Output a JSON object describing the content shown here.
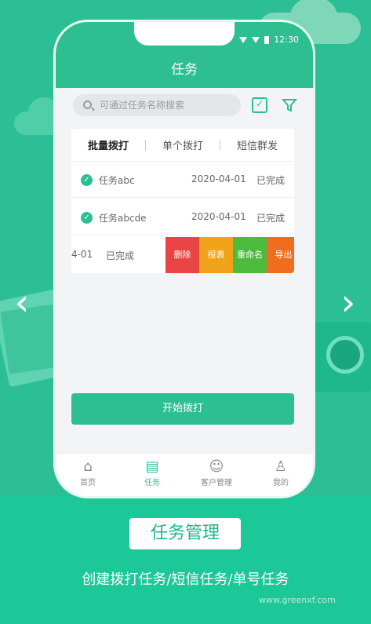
{
  "status_bar": {
    "time": "12:30"
  },
  "app": {
    "title": "任务"
  },
  "search": {
    "placeholder": "可通过任务名称搜索"
  },
  "tabs": [
    {
      "label": "批量拨打",
      "active": true
    },
    {
      "label": "单个拨打",
      "active": false
    },
    {
      "label": "短信群发",
      "active": false
    }
  ],
  "tasks": [
    {
      "name": "任务abc",
      "date": "2020-04-01",
      "status": "已完成"
    },
    {
      "name": "任务abcde",
      "date": "2020-04-01",
      "status": "已完成"
    },
    {
      "date": "-04-01",
      "status": "已完成"
    }
  ],
  "swipe_actions": [
    "删除",
    "报表",
    "重命名",
    "导出"
  ],
  "start_button": "开始拨打",
  "nav": [
    {
      "label": "首页",
      "icon": "home-icon"
    },
    {
      "label": "任务",
      "icon": "task-icon",
      "active": true
    },
    {
      "label": "客户管理",
      "icon": "customer-icon"
    },
    {
      "label": "我的",
      "icon": "profile-icon"
    }
  ],
  "promo": {
    "title": "任务管理",
    "subtitle": "创建拨打任务/短信任务/单号任务"
  },
  "watermark": "www.greenxf.com",
  "colors": {
    "primary": "#2dbf90",
    "delete": "#e94343",
    "report": "#f0a318",
    "rename": "#4dbb3e",
    "export": "#f06d1f"
  }
}
